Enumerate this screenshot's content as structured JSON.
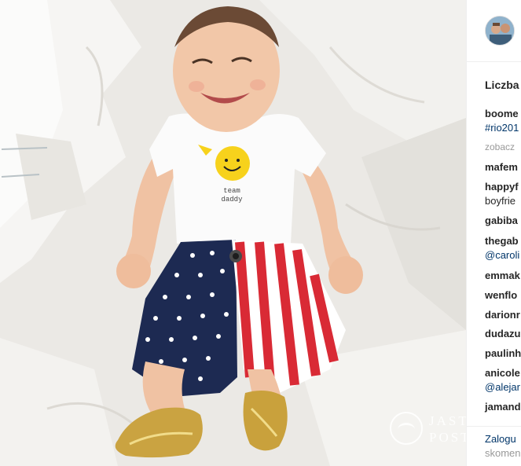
{
  "post": {
    "likes_text": "Liczba",
    "comments": [
      {
        "user": "boome",
        "text": ""
      },
      {
        "user": "",
        "text": "#rio201",
        "is_tag": true
      },
      {
        "user": "",
        "text": "zobacz",
        "is_more": true
      },
      {
        "user": "mafem",
        "text": ""
      },
      {
        "user": "happyf",
        "text": ""
      },
      {
        "user": "",
        "text": "boyfrie"
      },
      {
        "user": "gabiba",
        "text": ""
      },
      {
        "user": "thegab",
        "text": ""
      },
      {
        "user": "",
        "text": "@caroli",
        "is_tag": true
      },
      {
        "user": "emmak",
        "text": ""
      },
      {
        "user": "wenflo",
        "text": ""
      },
      {
        "user": "darionr",
        "text": ""
      },
      {
        "user": "dudazu",
        "text": ""
      },
      {
        "user": "paulinh",
        "text": ""
      },
      {
        "user": "anicole",
        "text": ""
      },
      {
        "user": "",
        "text": "@alejar",
        "is_tag": true
      },
      {
        "user": "jamand",
        "text": ""
      }
    ],
    "login_link": "Zalogu",
    "login_rest": "skomen"
  },
  "photo": {
    "onesie_text_line1": "team",
    "onesie_text_line2": "daddy",
    "watermark_line1": "JASTR",
    "watermark_line2": "POST"
  },
  "colors": {
    "tag": "#003569",
    "username": "#262626",
    "muted": "#999999"
  }
}
